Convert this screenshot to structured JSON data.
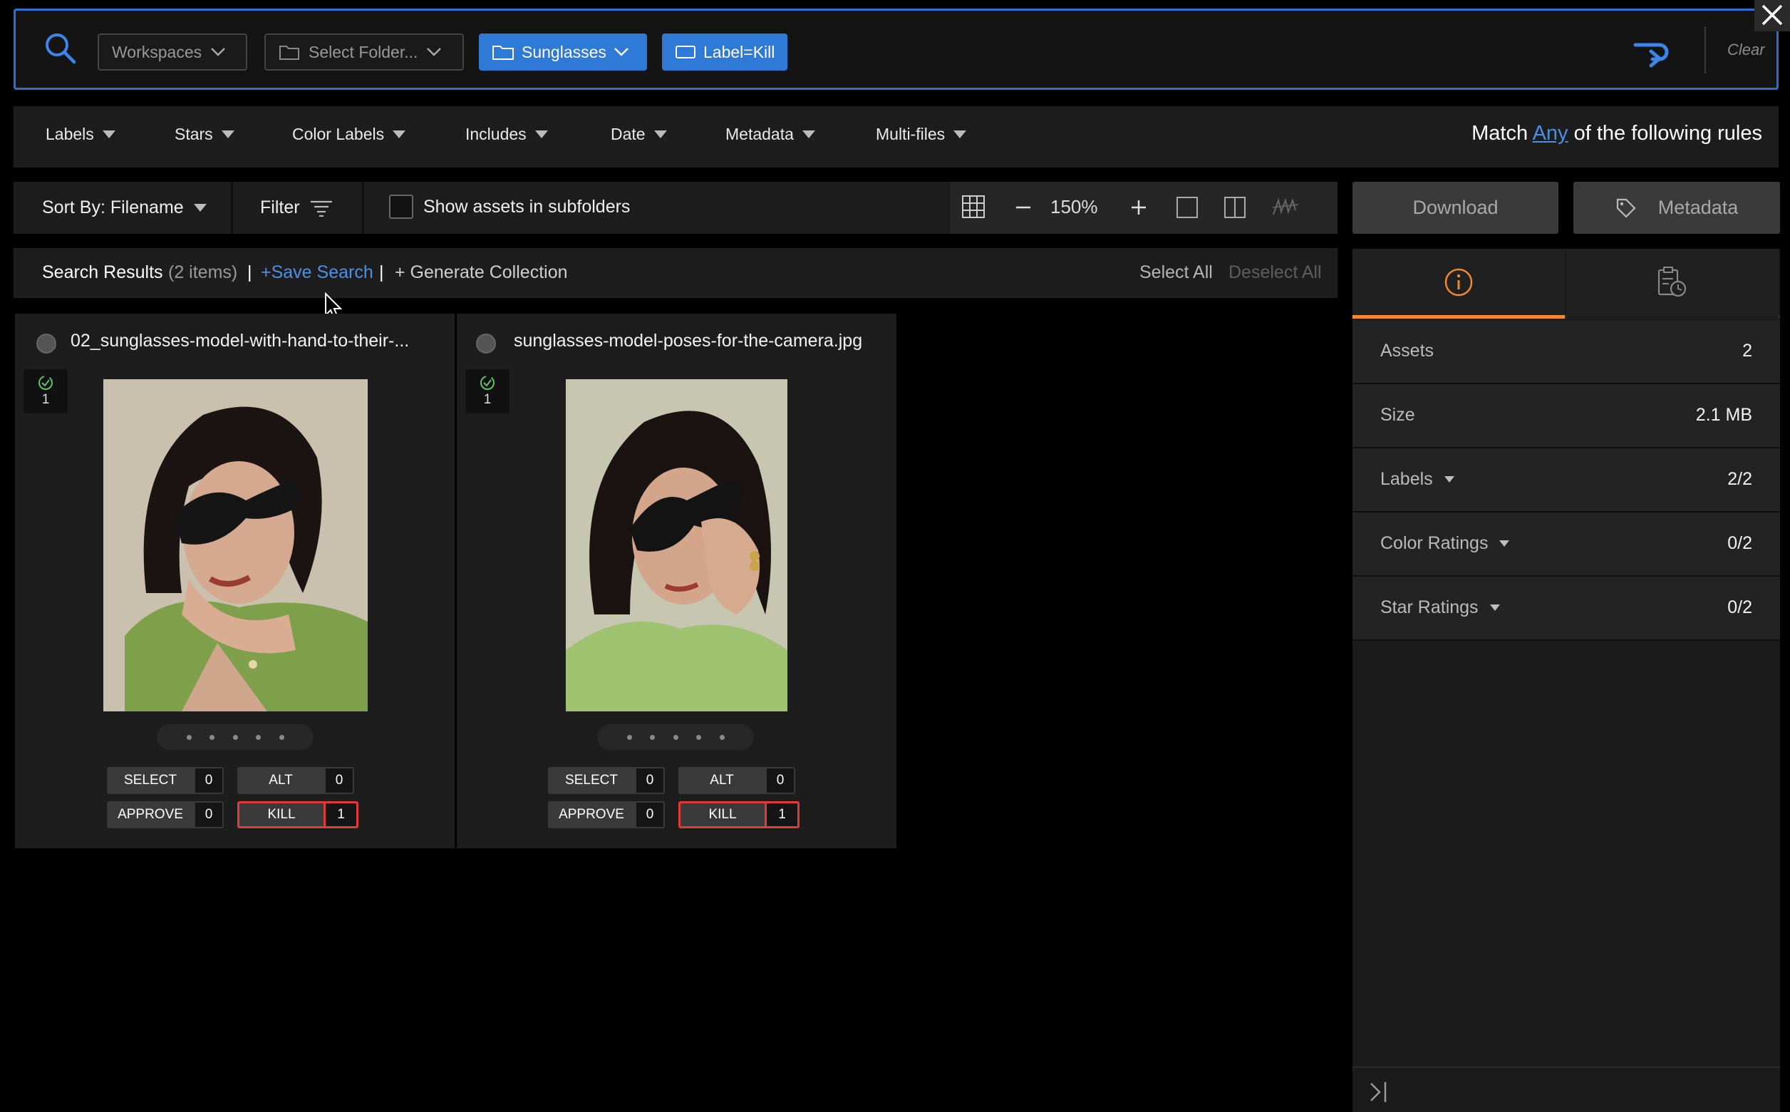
{
  "search": {
    "workspaces_label": "Workspaces",
    "folder_placeholder": "Select Folder...",
    "folder_chip": "Sunglasses",
    "label_chip": "Label=Kill",
    "clear_label": "Clear"
  },
  "filters": {
    "items": [
      "Labels",
      "Stars",
      "Color Labels",
      "Includes",
      "Date",
      "Metadata",
      "Multi-files"
    ],
    "match_prefix": "Match",
    "match_mode": "Any",
    "match_suffix": "of the following rules"
  },
  "toolbar": {
    "sort_label": "Sort By: Filename",
    "filter_label": "Filter",
    "subfolders_label": "Show assets in subfolders",
    "zoom_value": "150%"
  },
  "results": {
    "title": "Search Results",
    "count": "(2 items)",
    "sep1": "|",
    "save_search": "+Save Search",
    "sep2": "|",
    "generate": "+ Generate Collection",
    "select_all": "Select All",
    "deselect_all": "Deselect All"
  },
  "assets": [
    {
      "filename": "02_sunglasses-model-with-hand-to-their-...",
      "version": "1",
      "labels": [
        {
          "name": "SELECT",
          "count": "0"
        },
        {
          "name": "ALT",
          "count": "0"
        },
        {
          "name": "APPROVE",
          "count": "0"
        },
        {
          "name": "KILL",
          "count": "1"
        }
      ]
    },
    {
      "filename": "sunglasses-model-poses-for-the-camera.jpg",
      "version": "1",
      "labels": [
        {
          "name": "SELECT",
          "count": "0"
        },
        {
          "name": "ALT",
          "count": "0"
        },
        {
          "name": "APPROVE",
          "count": "0"
        },
        {
          "name": "KILL",
          "count": "1"
        }
      ]
    }
  ],
  "side": {
    "download_label": "Download",
    "metadata_label": "Metadata",
    "rows": [
      {
        "key": "Assets",
        "value": "2"
      },
      {
        "key": "Size",
        "value": "2.1 MB"
      },
      {
        "key": "Labels",
        "value": "2/2"
      },
      {
        "key": "Color Ratings",
        "value": "0/2"
      },
      {
        "key": "Star Ratings",
        "value": "0/2"
      }
    ]
  },
  "colors": {
    "accent_blue": "#2e7ad6",
    "kill_red": "#e03b3b",
    "tab_orange": "#f08a2c"
  },
  "icons": [
    "search-icon",
    "chevron-down-icon",
    "folder-icon",
    "tag-icon",
    "redo-icon",
    "close-icon",
    "filter-icon",
    "grid-icon",
    "zoom-out-icon",
    "zoom-in-icon",
    "single-view-icon",
    "split-view-icon",
    "signature-icon",
    "info-icon",
    "history-icon",
    "version-check-icon",
    "collapse-panel-icon"
  ]
}
